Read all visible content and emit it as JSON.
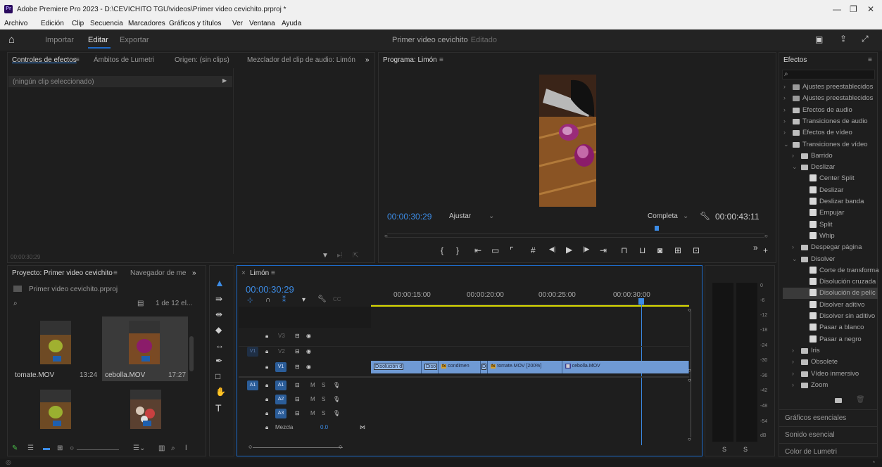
{
  "titlebar": {
    "logo": "Pr",
    "title": "Adobe Premiere Pro 2023 - D:\\CEVICHITO TGU\\videos\\Primer video cevichito.prproj *",
    "min": "—",
    "max": "❐",
    "close": "✕"
  },
  "menu": [
    "Archivo",
    "Edición",
    "Clip",
    "Secuencia",
    "Marcadores",
    "Gráficos y títulos",
    "Ver",
    "Ventana",
    "Ayuda"
  ],
  "workspace": {
    "tabs": [
      "Importar",
      "Editar",
      "Exportar"
    ],
    "project_title": "Primer video cevichito",
    "project_state": "- Editado"
  },
  "source_panel": {
    "tabs": [
      "Controles de efectos",
      "Ámbitos de Lumetri",
      "Origen: (sin clips)",
      "Mezclador del clip de audio: Limón"
    ],
    "no_clip": "(ningún clip seleccionado)",
    "timecode": "00:00:30:29"
  },
  "program": {
    "title": "Programa: Limón",
    "timecode": "00:00:30:29",
    "fit": "Ajustar",
    "quality": "Completa",
    "duration": "00:00:43:11"
  },
  "project": {
    "tabs": [
      "Proyecto: Primer video cevichito",
      "Navegador de me"
    ],
    "file": "Primer video cevichito.prproj",
    "count": "1 de 12 el...",
    "items": [
      {
        "name": "tomate.MOV",
        "duration": "13:24"
      },
      {
        "name": "cebolla.MOV",
        "duration": "17:27"
      }
    ]
  },
  "timeline": {
    "tab": "Limón",
    "timecode": "00:00:30:29",
    "ruler": [
      "00:00:15:00",
      "00:00:20:00",
      "00:00:25:00",
      "00:00:30:00"
    ],
    "tracks": {
      "v3": "V3",
      "v2": "V2",
      "v1": "V1",
      "v1src": "V1",
      "a1": "A1",
      "a1src": "A1",
      "a2": "A2",
      "a3": "A3",
      "m": "M",
      "s": "S",
      "mix": "Mezcla",
      "mix_val": "0.0"
    },
    "clips": {
      "dis1": "Disolución d",
      "dis2": "Diso",
      "fx": "fx",
      "cond": "condimen",
      "d": "D",
      "tomate": "tomate.MOV [200%]",
      "cebolla": "cebolla.MOV"
    }
  },
  "meters": {
    "labels": [
      "0",
      "-6",
      "-12",
      "-18",
      "-24",
      "-30",
      "-36",
      "-42",
      "-48",
      "-54",
      "dB"
    ],
    "solo_left": "S",
    "solo_right": "S"
  },
  "effects": {
    "title": "Efectos",
    "items": [
      {
        "label": "Ajustes preestablecidos",
        "type": "fold2"
      },
      {
        "label": "Ajustes preestablecidos",
        "type": "fold2"
      },
      {
        "label": "Efectos de audio",
        "type": "fold"
      },
      {
        "label": "Transiciones de audio",
        "type": "fold"
      },
      {
        "label": "Efectos de vídeo",
        "type": "fold"
      },
      {
        "label": "Transiciones de vídeo",
        "type": "fold"
      },
      {
        "label": "Barrido",
        "type": "fold"
      },
      {
        "label": "Deslizar",
        "type": "fold"
      },
      {
        "label": "Center Split",
        "type": "trn"
      },
      {
        "label": "Deslizar",
        "type": "trn"
      },
      {
        "label": "Deslizar banda",
        "type": "trn"
      },
      {
        "label": "Empujar",
        "type": "trn"
      },
      {
        "label": "Split",
        "type": "trn"
      },
      {
        "label": "Whip",
        "type": "trn"
      },
      {
        "label": "Despegar página",
        "type": "fold"
      },
      {
        "label": "Disolver",
        "type": "fold"
      },
      {
        "label": "Corte de transforma",
        "type": "trn"
      },
      {
        "label": "Disolución cruzada",
        "type": "trn"
      },
      {
        "label": "Disolución de pelíc",
        "type": "trn"
      },
      {
        "label": "Disolver aditivo",
        "type": "trn"
      },
      {
        "label": "Disolver sin aditivo",
        "type": "trn"
      },
      {
        "label": "Pasar a blanco",
        "type": "trn"
      },
      {
        "label": "Pasar a negro",
        "type": "trn"
      },
      {
        "label": "Iris",
        "type": "fold"
      },
      {
        "label": "Obsolete",
        "type": "fold"
      },
      {
        "label": "Vídeo inmersivo",
        "type": "fold"
      },
      {
        "label": "Zoom",
        "type": "fold"
      }
    ],
    "panels": [
      "Gráficos esenciales",
      "Sonido esencial",
      "Color de Lumetri"
    ]
  },
  "colors": {
    "accent": "#3c8ce6",
    "clip": "#6f9ad4",
    "workarea": "#d8d800"
  }
}
